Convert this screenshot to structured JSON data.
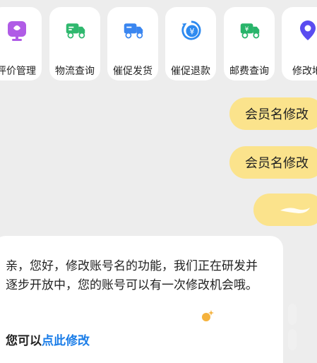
{
  "quick_actions": [
    {
      "label": "评价管理",
      "icon": "review-icon",
      "color": "#b05ce6"
    },
    {
      "label": "物流查询",
      "icon": "logistics-truck-icon",
      "color": "#2fb86e"
    },
    {
      "label": "催促发货",
      "icon": "urge-delivery-truck-icon",
      "color": "#3a86f0"
    },
    {
      "label": "催促退款",
      "icon": "urge-refund-icon",
      "color": "#2d8af0"
    },
    {
      "label": "邮费查询",
      "icon": "postage-query-icon",
      "color": "#28b46a"
    },
    {
      "label": "修改地",
      "icon": "location-pin-icon",
      "color": "#5a4cf0"
    }
  ],
  "chat": {
    "user_messages": [
      "会员名修改",
      "会员名修改"
    ],
    "reply_text": "亲，您好，修改账号名的功能，我们正在研发并逐步开放中，您的账号可以有一次修改机会哦。",
    "reply_prefix": "您可以",
    "reply_link": "点此修改"
  }
}
